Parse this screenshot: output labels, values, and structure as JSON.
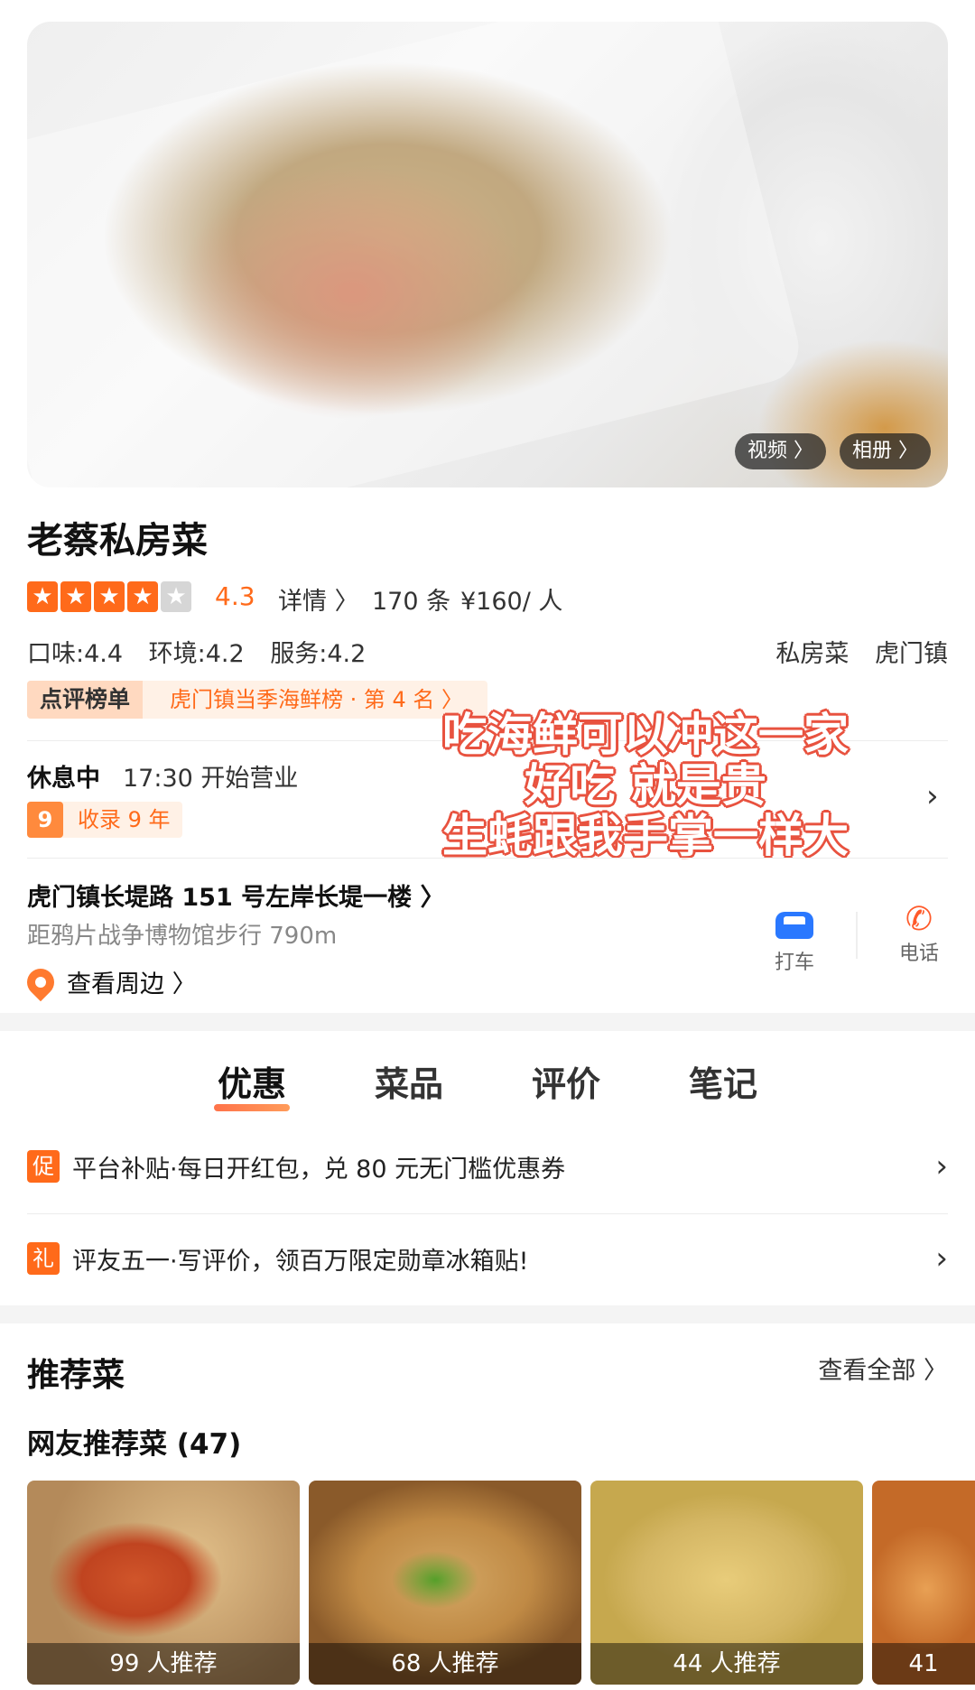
{
  "hero": {
    "buttons": {
      "video": "视频 〉",
      "album": "相册 〉"
    }
  },
  "shop": {
    "name": "老蔡私房菜",
    "rating": "4.3",
    "stars": 4,
    "detail_link": "详情 〉",
    "review_count": "170 条",
    "price": "¥160/ 人",
    "scores": [
      "口味:4.4",
      "环境:4.2",
      "服务:4.2"
    ],
    "tags": [
      "私房菜",
      "虎门镇"
    ],
    "rank_badge": "点评榜单",
    "rank_text": "虎门镇当季海鲜榜 · 第 4 名 〉"
  },
  "status": {
    "state": "休息中",
    "hours": "17:30 开始营业",
    "listed_badge": "9",
    "listed_text": "收录 9 年"
  },
  "overlay_caption": [
    "吃海鲜可以冲这一家",
    "好吃  就是贵",
    "生蚝跟我手掌一样大"
  ],
  "location": {
    "address": "虎门镇长堤路 151 号左岸长堤一楼 〉",
    "distance": "距鸦片战争博物馆步行 790m",
    "nearby": "查看周边 〉",
    "actions": [
      {
        "icon": "taxi-icon",
        "label": "打车"
      },
      {
        "icon": "phone-icon",
        "label": "电话"
      }
    ]
  },
  "tabs": [
    "优惠",
    "菜品",
    "评价",
    "笔记"
  ],
  "promos": [
    {
      "icon": "促",
      "text": "平台补贴·每日开红包，兑 80 元无门槛优惠券"
    },
    {
      "icon": "礼",
      "text": "评友五一·写评价，领百万限定勋章冰箱贴!"
    }
  ],
  "recommend": {
    "title": "推荐菜",
    "see_all": "查看全部 〉",
    "subtitle": "网友推荐菜 (47)",
    "dishes": [
      {
        "label": "99 人推荐"
      },
      {
        "label": "68 人推荐"
      },
      {
        "label": "44 人推荐"
      },
      {
        "label": "41"
      }
    ]
  },
  "colors": {
    "accent": "#ff6a1a",
    "overlay_outline": "#e8523f",
    "taxi": "#2a78ff"
  }
}
